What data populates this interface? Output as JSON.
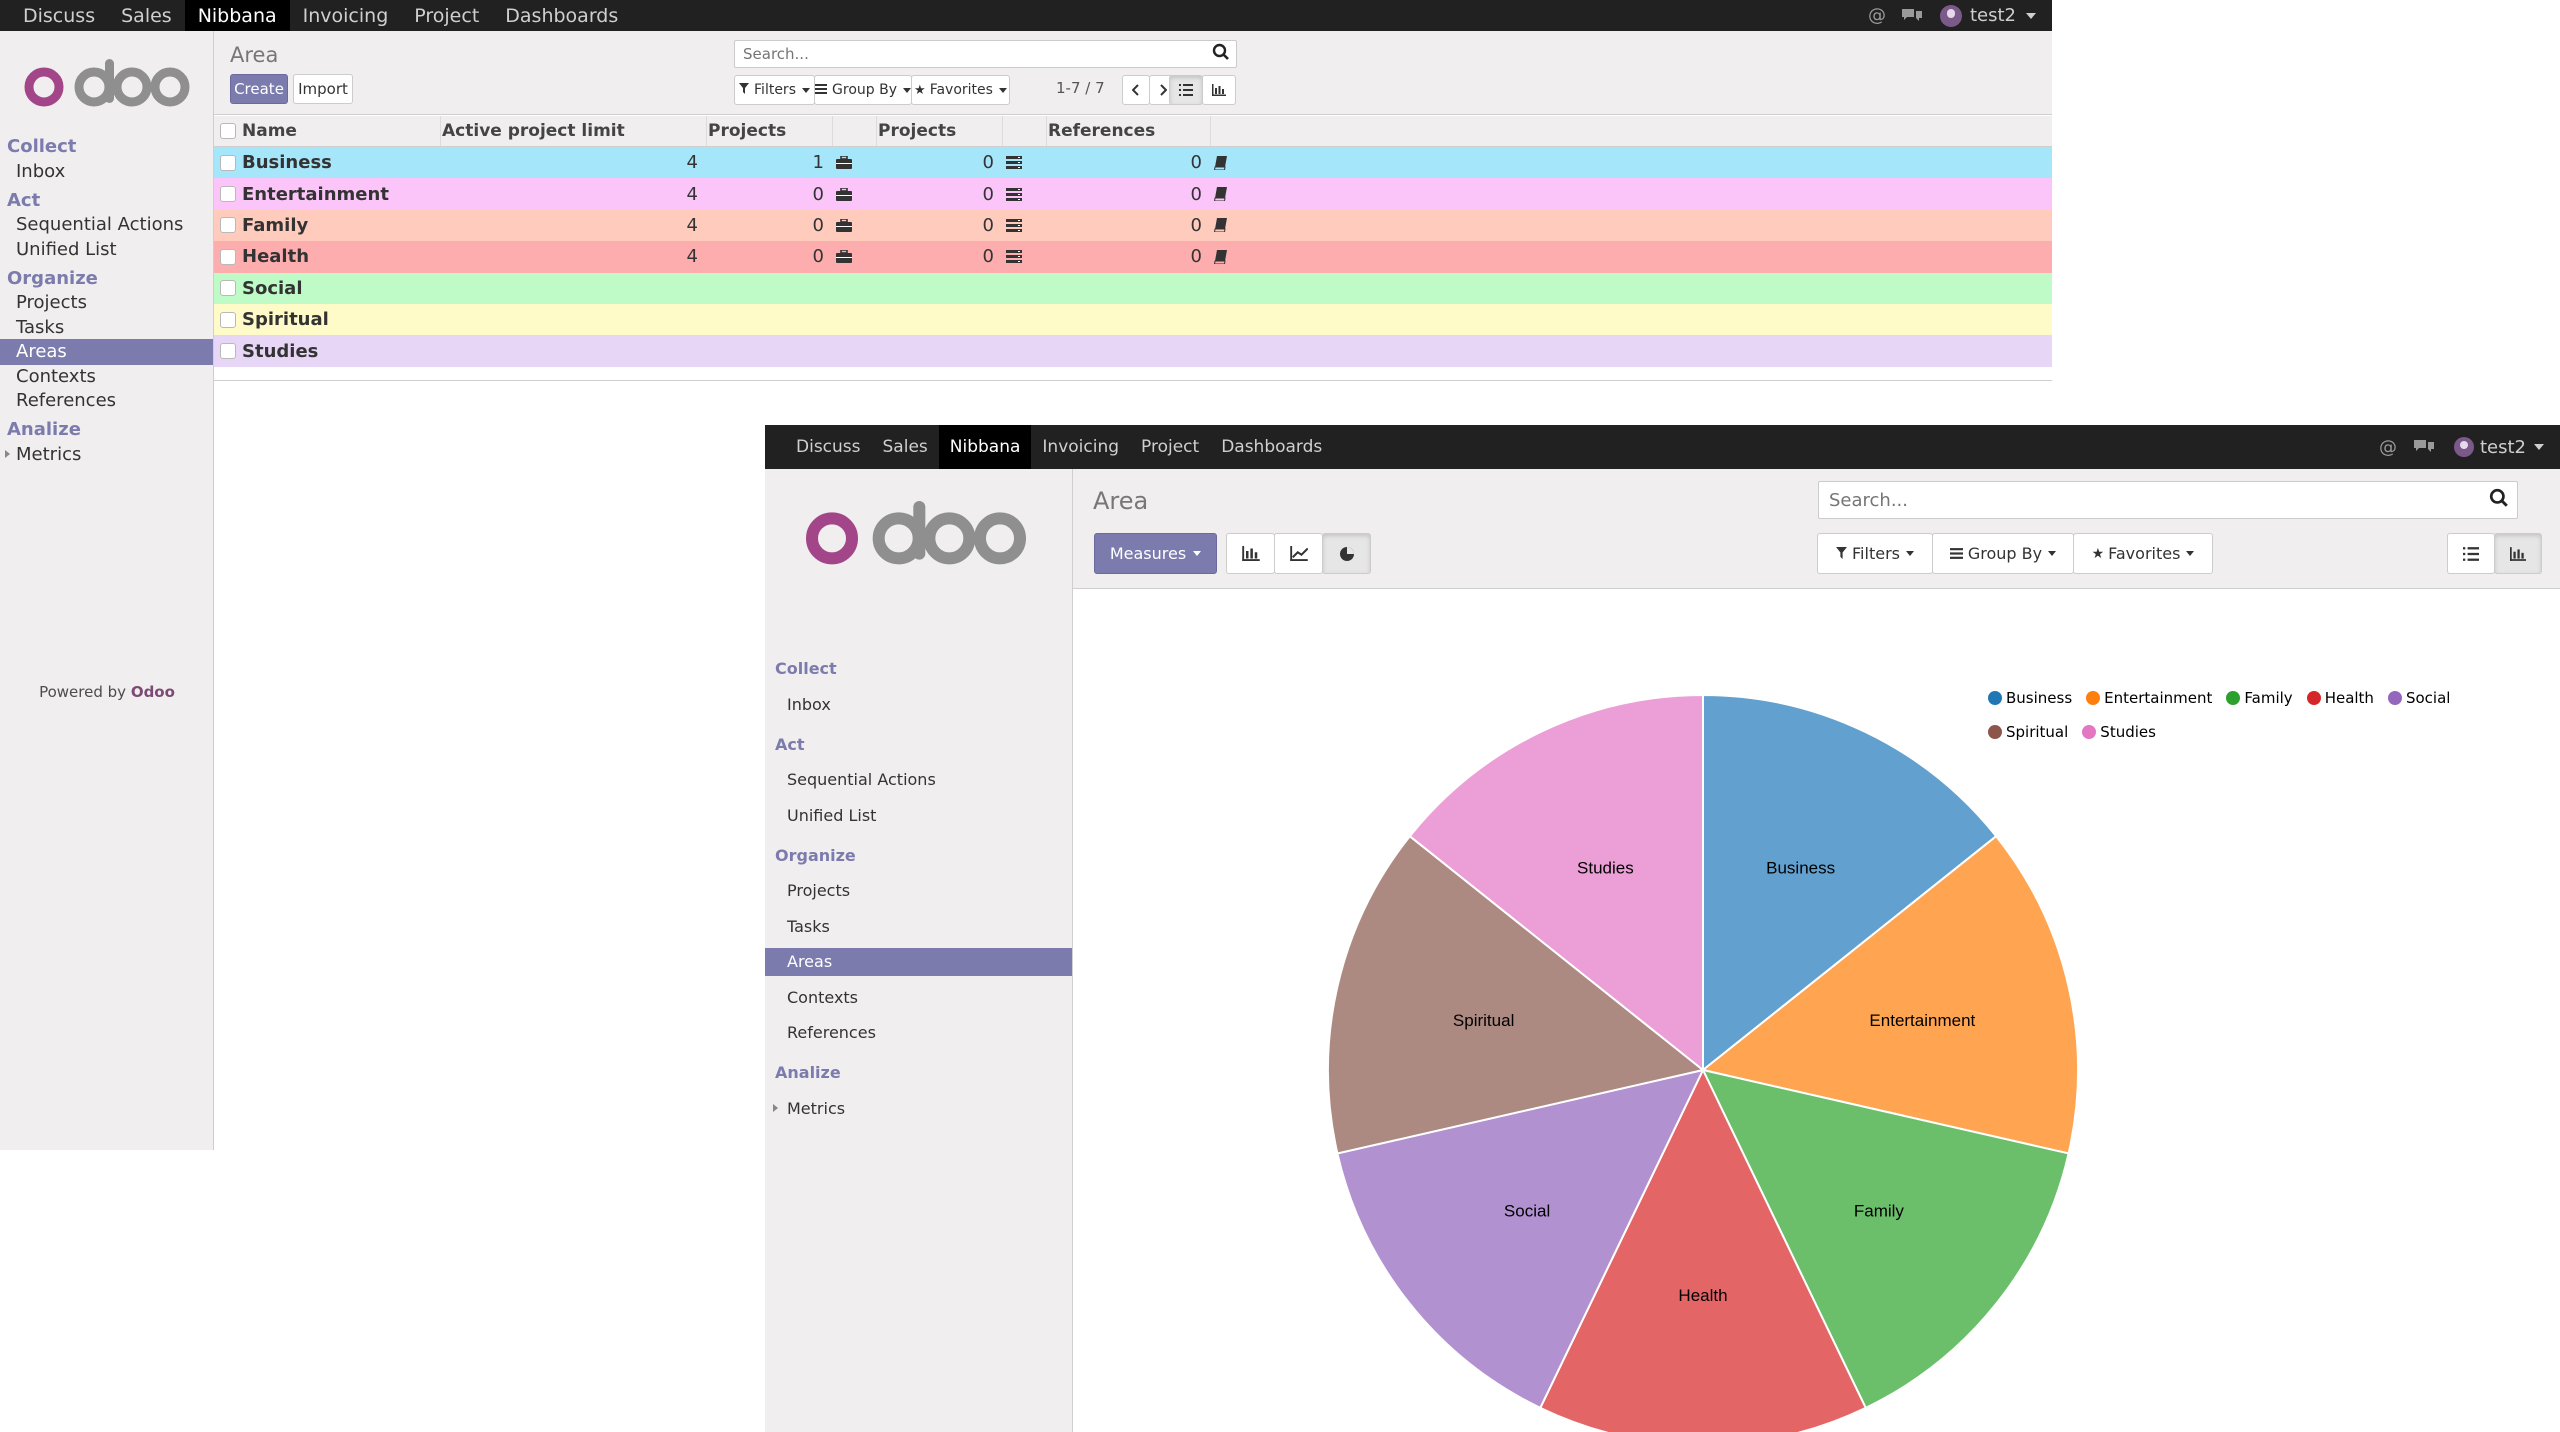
{
  "menu": [
    "Discuss",
    "Sales",
    "Nibbana",
    "Invoicing",
    "Project",
    "Dashboards"
  ],
  "menu_active": "Nibbana",
  "user_name": "test2",
  "sidebar": {
    "sections": [
      {
        "title": "Collect",
        "items": [
          "Inbox"
        ]
      },
      {
        "title": "Act",
        "items": [
          "Sequential Actions",
          "Unified List"
        ]
      },
      {
        "title": "Organize",
        "items": [
          "Projects",
          "Tasks",
          "Areas",
          "Contexts",
          "References"
        ]
      },
      {
        "title": "Analize",
        "items": [
          "Metrics"
        ]
      }
    ],
    "active_item": "Areas",
    "powered_by": "Powered by",
    "powered_brand": "Odoo"
  },
  "list_window": {
    "breadcrumb": "Area",
    "create_label": "Create",
    "import_label": "Import",
    "search_placeholder": "Search...",
    "filters_label": "Filters",
    "groupby_label": "Group By",
    "favorites_label": "Favorites",
    "pager": "1-7 / 7",
    "columns": [
      "Name",
      "Active project limit",
      "Projects",
      "Projects",
      "References"
    ],
    "rows": [
      {
        "name": "Business",
        "limit": "4",
        "projects_a": "1",
        "projects_b": "0",
        "refs": "0",
        "color": "#a6e6fa"
      },
      {
        "name": "Entertainment",
        "limit": "4",
        "projects_a": "0",
        "projects_b": "0",
        "refs": "0",
        "color": "#fcc5f9"
      },
      {
        "name": "Family",
        "limit": "4",
        "projects_a": "0",
        "projects_b": "0",
        "refs": "0",
        "color": "#fecbbd"
      },
      {
        "name": "Health",
        "limit": "4",
        "projects_a": "0",
        "projects_b": "0",
        "refs": "0",
        "color": "#fdadad"
      },
      {
        "name": "Social",
        "limit": "",
        "projects_a": "",
        "projects_b": "",
        "refs": "",
        "color": "#befbc6"
      },
      {
        "name": "Spiritual",
        "limit": "",
        "projects_a": "",
        "projects_b": "",
        "refs": "",
        "color": "#fefbc9"
      },
      {
        "name": "Studies",
        "limit": "",
        "projects_a": "",
        "projects_b": "",
        "refs": "",
        "color": "#e7d6f5"
      }
    ]
  },
  "graph_window": {
    "breadcrumb": "Area",
    "measures_label": "Measures",
    "search_placeholder": "Search...",
    "filters_label": "Filters",
    "groupby_label": "Group By",
    "favorites_label": "Favorites"
  },
  "chart_data": {
    "type": "pie",
    "categories": [
      "Business",
      "Entertainment",
      "Family",
      "Health",
      "Social",
      "Spiritual",
      "Studies"
    ],
    "values": [
      1,
      1,
      1,
      1,
      1,
      1,
      1
    ],
    "colors": [
      "#1f77b4",
      "#ff7f0e",
      "#2ca02c",
      "#d62728",
      "#9467bd",
      "#8c564b",
      "#e377c2"
    ],
    "slice_colors": [
      "#61a0cf",
      "#ffa552",
      "#6bbf6b",
      "#e46566",
      "#b291d1",
      "#ad8a81",
      "#eb9fd6"
    ],
    "legend": [
      "Business",
      "Entertainment",
      "Family",
      "Health",
      "Social",
      "Spiritual",
      "Studies"
    ],
    "legend_position": "top-right"
  }
}
